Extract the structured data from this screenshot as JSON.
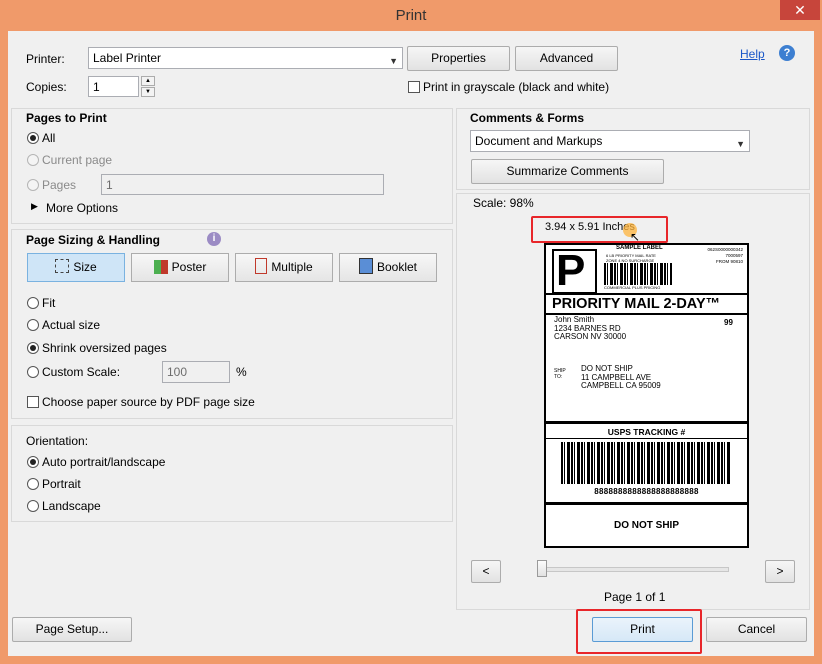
{
  "window": {
    "title": "Print",
    "close_glyph": "✕"
  },
  "header": {
    "printer_label": "Printer:",
    "printer_value": "Label Printer",
    "properties_button": "Properties",
    "advanced_button": "Advanced",
    "help_link": "Help",
    "help_icon_glyph": "?",
    "copies_label": "Copies:",
    "copies_value": "1",
    "grayscale_label": "Print in grayscale (black and white)"
  },
  "pages_to_print": {
    "title": "Pages to Print",
    "all_label": "All",
    "current_page_label": "Current page",
    "pages_label": "Pages",
    "pages_value": "1",
    "more_options_label": "More Options"
  },
  "page_sizing": {
    "title": "Page Sizing & Handling",
    "tabs": {
      "size": "Size",
      "poster": "Poster",
      "multiple": "Multiple",
      "booklet": "Booklet"
    },
    "fit_label": "Fit",
    "actual_size_label": "Actual size",
    "shrink_label": "Shrink oversized pages",
    "custom_scale_label": "Custom Scale:",
    "custom_scale_value": "100",
    "percent": "%",
    "paper_source_label": "Choose paper source by PDF page size"
  },
  "orientation": {
    "title": "Orientation:",
    "auto_label": "Auto portrait/landscape",
    "portrait_label": "Portrait",
    "landscape_label": "Landscape"
  },
  "comments_forms": {
    "title": "Comments & Forms",
    "select_value": "Document and Markups",
    "summarize_button": "Summarize Comments"
  },
  "preview": {
    "scale_text": "Scale:  98%",
    "dimensions_text": "3.94 x 5.91 Inches",
    "nav_prev": "<",
    "nav_next": ">",
    "slider_value": 0,
    "page_indicator": "Page 1 of 1",
    "label": {
      "big_letter": "P",
      "sample_text": "SAMPLE LABEL",
      "top_right_lines": [
        "062S0000000342",
        "7000597",
        "FROM 90810"
      ],
      "top_mid_lines": [
        "6 LB PRIORITY MAIL RATE",
        "ZONE 4 NO SURCHARGE",
        "COMMERCIAL PLUS PRICING"
      ],
      "service": "PRIORITY MAIL 2-DAY™",
      "from_name": "John Smith",
      "from_street": "1234 BARNES RD",
      "from_city": "CARSON NV 30000",
      "zone_code": "99",
      "ship_to_label": "SHIP TO:",
      "to_name": "DO NOT SHIP",
      "to_street": "11 CAMPBELL AVE",
      "to_city": "CAMPBELL CA 95009",
      "tracking_title": "USPS TRACKING #",
      "tracking_number": "8888888888888888888888",
      "footer": "DO NOT SHIP"
    }
  },
  "footer": {
    "page_setup_button": "Page Setup...",
    "print_button": "Print",
    "cancel_button": "Cancel"
  },
  "colors": {
    "titlebar": "#f09a6a",
    "highlight_red": "#e8262a",
    "link_blue": "#1a57c8",
    "active_tab": "#cfe5f7"
  }
}
